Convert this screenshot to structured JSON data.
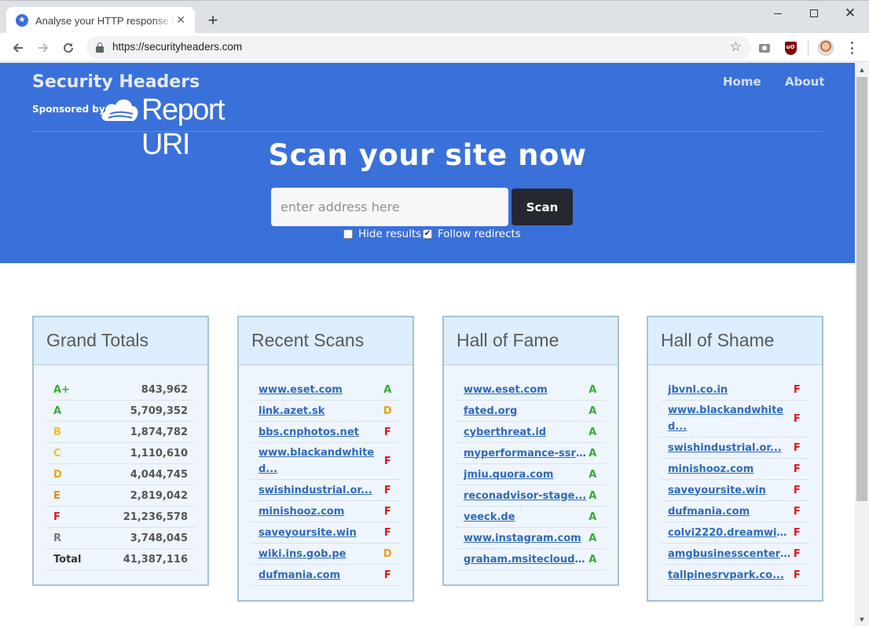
{
  "browser": {
    "tab_title": "Analyse your HTTP response headers",
    "tab_close": "✕",
    "new_tab": "+",
    "url": "https://securityheaders.com"
  },
  "header": {
    "title": "Security Headers",
    "sponsored_by": "Sponsored by",
    "sponsor_name": "Report URI",
    "nav": {
      "home": "Home",
      "about": "About"
    }
  },
  "hero": {
    "headline": "Scan your site now",
    "input_placeholder": "enter address here",
    "input_value": "",
    "scan_button": "Scan",
    "hide_results_label": "Hide results",
    "hide_results_checked": false,
    "follow_redirects_label": "Follow redirects",
    "follow_redirects_checked": true
  },
  "grand_totals": {
    "title": "Grand Totals",
    "rows": [
      {
        "grade": "A+",
        "count": "843,962"
      },
      {
        "grade": "A",
        "count": "5,709,352"
      },
      {
        "grade": "B",
        "count": "1,874,782"
      },
      {
        "grade": "C",
        "count": "1,110,610"
      },
      {
        "grade": "D",
        "count": "4,044,745"
      },
      {
        "grade": "E",
        "count": "2,819,042"
      },
      {
        "grade": "F",
        "count": "21,236,578"
      },
      {
        "grade": "R",
        "count": "3,748,045"
      }
    ],
    "total_label": "Total",
    "total_count": "41,387,116"
  },
  "recent_scans": {
    "title": "Recent Scans",
    "rows": [
      {
        "site": "www.eset.com",
        "grade": "A"
      },
      {
        "site": "link.azet.sk",
        "grade": "D"
      },
      {
        "site": "bbs.cnphotos.net",
        "grade": "F"
      },
      {
        "site": "www.blackandwhited...",
        "grade": "F"
      },
      {
        "site": "swishindustrial.or...",
        "grade": "F"
      },
      {
        "site": "minishooz.com",
        "grade": "F"
      },
      {
        "site": "saveyoursite.win",
        "grade": "F"
      },
      {
        "site": "wiki.ins.gob.pe",
        "grade": "D"
      },
      {
        "site": "dufmania.com",
        "grade": "F"
      }
    ]
  },
  "hall_of_fame": {
    "title": "Hall of Fame",
    "rows": [
      {
        "site": "www.eset.com",
        "grade": "A"
      },
      {
        "site": "fated.org",
        "grade": "A"
      },
      {
        "site": "cyberthreat.id",
        "grade": "A"
      },
      {
        "site": "myperformance-ssrs...",
        "grade": "A"
      },
      {
        "site": "jmiu.quora.com",
        "grade": "A"
      },
      {
        "site": "reconadvisor-stage...",
        "grade": "A"
      },
      {
        "site": "veeck.de",
        "grade": "A"
      },
      {
        "site": "www.instagram.com",
        "grade": "A"
      },
      {
        "site": "graham.msitecloud....",
        "grade": "A"
      }
    ]
  },
  "hall_of_shame": {
    "title": "Hall of Shame",
    "rows": [
      {
        "site": "jbvnl.co.in",
        "grade": "F"
      },
      {
        "site": "www.blackandwhited...",
        "grade": "F"
      },
      {
        "site": "swishindustrial.or...",
        "grade": "F"
      },
      {
        "site": "minishooz.com",
        "grade": "F"
      },
      {
        "site": "saveyoursite.win",
        "grade": "F"
      },
      {
        "site": "dufmania.com",
        "grade": "F"
      },
      {
        "site": "colvi2220.dreamwid...",
        "grade": "F"
      },
      {
        "site": "amgbusinesscenters...",
        "grade": "F"
      },
      {
        "site": "tallpinesrvpark.co...",
        "grade": "F"
      }
    ]
  },
  "colors": {
    "hero_blue": "#3a70d9",
    "scan_button": "#252830",
    "grade_a": "#39a83a",
    "grade_f": "#e0161d",
    "grade_d": "#e3a21b",
    "link": "#2f6ab8"
  },
  "icons": {
    "back": "arrow-left-icon",
    "forward": "arrow-right-icon",
    "reload": "reload-icon",
    "lock": "lock-icon",
    "bookmark": "star-icon",
    "camera": "camera-icon",
    "ublock": "ublock-icon",
    "menu": "more-vert-icon"
  }
}
